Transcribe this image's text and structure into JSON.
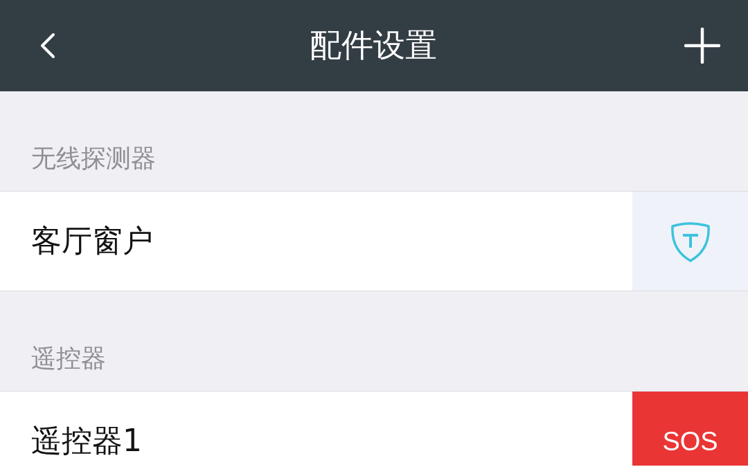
{
  "header": {
    "title": "配件设置"
  },
  "sections": [
    {
      "title": "无线探测器",
      "items": [
        {
          "name": "客厅窗户",
          "action": {
            "kind": "shield"
          }
        }
      ]
    },
    {
      "title": "遥控器",
      "items": [
        {
          "name": "遥控器1",
          "action": {
            "kind": "sos",
            "label": "SOS"
          }
        }
      ]
    }
  ]
}
